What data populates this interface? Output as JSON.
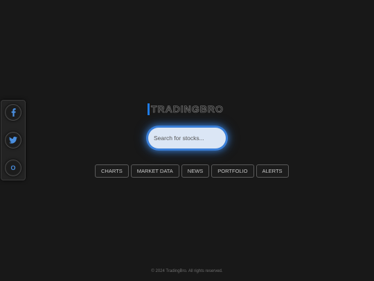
{
  "logo": {
    "text": "TRADINGBRO"
  },
  "social": [
    {
      "name": "facebook",
      "icon": "facebook-icon"
    },
    {
      "name": "twitter",
      "icon": "twitter-icon"
    },
    {
      "name": "other",
      "label": "O"
    }
  ],
  "search": {
    "placeholder": "Search for stocks...",
    "value": ""
  },
  "nav": {
    "items": [
      {
        "label": "CHARTS"
      },
      {
        "label": "MARKET DATA"
      },
      {
        "label": "NEWS"
      },
      {
        "label": "PORTFOLIO"
      },
      {
        "label": "ALERTS"
      }
    ]
  },
  "footer": {
    "text": "© 2024 TradingBro. All rights reserved."
  },
  "colors": {
    "accent": "#1e7be6",
    "background": "#181818",
    "icon": "#4a8fe0"
  }
}
